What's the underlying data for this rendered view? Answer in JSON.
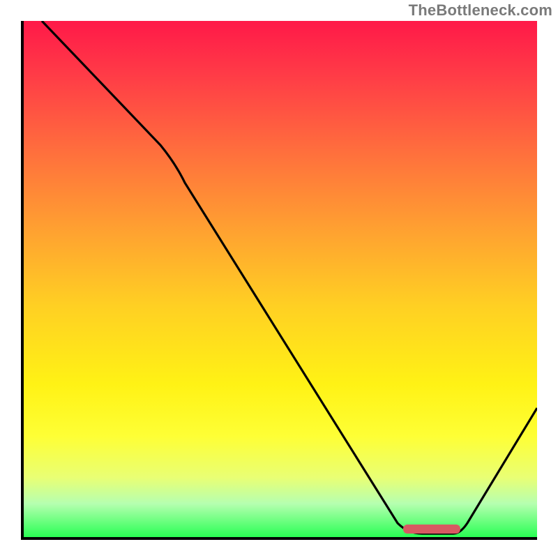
{
  "watermark": "TheBottleneck.com",
  "chart_data": {
    "type": "line",
    "title": "",
    "xlabel": "",
    "ylabel": "",
    "x_range": [
      0,
      100
    ],
    "y_range": [
      0,
      100
    ],
    "curve_points": [
      {
        "x": 4,
        "y": 100
      },
      {
        "x": 27,
        "y": 76
      },
      {
        "x": 30,
        "y": 72
      },
      {
        "x": 73,
        "y": 3
      },
      {
        "x": 76,
        "y": 1
      },
      {
        "x": 84,
        "y": 1
      },
      {
        "x": 100,
        "y": 26
      }
    ],
    "optimum_band": {
      "x_start": 74,
      "x_end": 85,
      "y": 1.5
    },
    "gradient_stops": [
      {
        "pos": 0,
        "color": "#ff1948"
      },
      {
        "pos": 25,
        "color": "#ff6e3d"
      },
      {
        "pos": 55,
        "color": "#ffd023"
      },
      {
        "pos": 80,
        "color": "#feff35"
      },
      {
        "pos": 100,
        "color": "#1dff4c"
      }
    ]
  }
}
